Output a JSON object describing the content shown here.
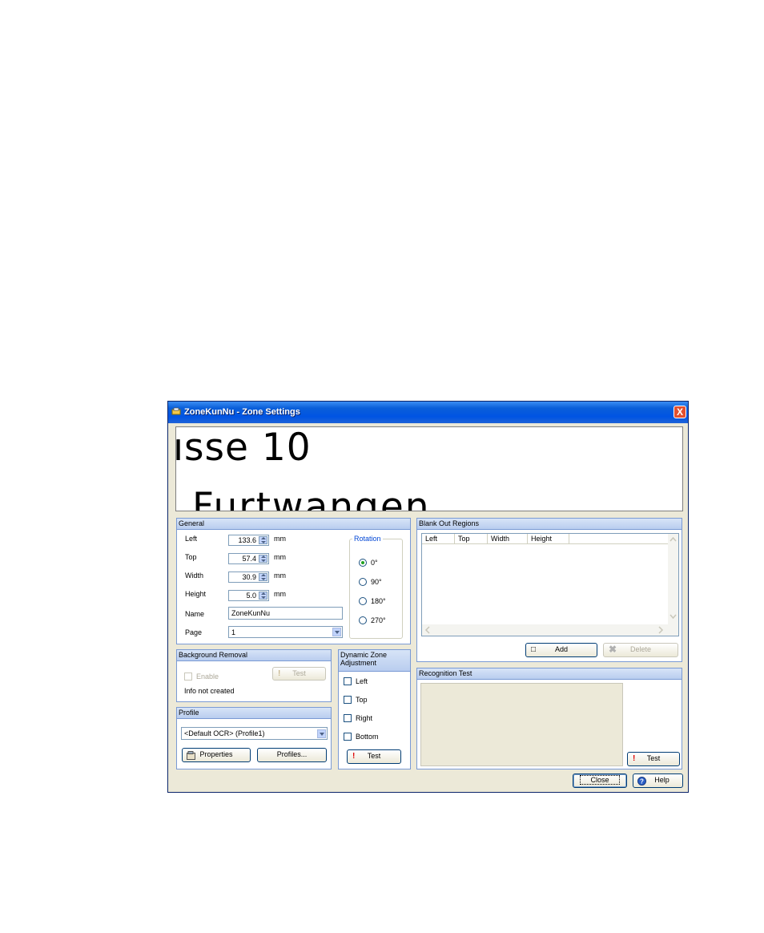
{
  "window": {
    "title": "ZoneKunNu - Zone Settings",
    "close_glyph": "X",
    "title_bar_color": "#0054e3"
  },
  "preview": {
    "line1": "ısse 10",
    "line2": "Furtwangen"
  },
  "general": {
    "header": "General",
    "fields": [
      {
        "label": "Left",
        "value": "133.6",
        "unit": "mm"
      },
      {
        "label": "Top",
        "value": "57.4",
        "unit": "mm"
      },
      {
        "label": "Width",
        "value": "30.9",
        "unit": "mm"
      },
      {
        "label": "Height",
        "value": "5.0",
        "unit": "mm"
      }
    ],
    "name_label": "Name",
    "name_value": "ZoneKunNu",
    "page_label": "Page",
    "page_value": "1",
    "rotation": {
      "title": "Rotation",
      "options": [
        "0°",
        "90°",
        "180°",
        "270°"
      ],
      "selected": "0°"
    }
  },
  "blank_out": {
    "header": "Blank Out Regions",
    "columns": [
      "Left",
      "Top",
      "Width",
      "Height"
    ],
    "add_label": "Add",
    "delete_label": "Delete"
  },
  "background_removal": {
    "header": "Background Removal",
    "enable_label": "Enable",
    "test_label": "Test",
    "info": "Info not created"
  },
  "dynamic_zone": {
    "header": "Dynamic Zone Adjustment",
    "options": [
      "Left",
      "Top",
      "Right",
      "Bottom"
    ],
    "test_label": "Test"
  },
  "profile": {
    "header": "Profile",
    "selected": "<Default OCR> (Profile1)",
    "properties_label": "Properties",
    "profiles_label": "Profiles..."
  },
  "recognition_test": {
    "header": "Recognition Test",
    "test_label": "Test"
  },
  "footer": {
    "close_label": "Close",
    "help_label": "Help"
  }
}
